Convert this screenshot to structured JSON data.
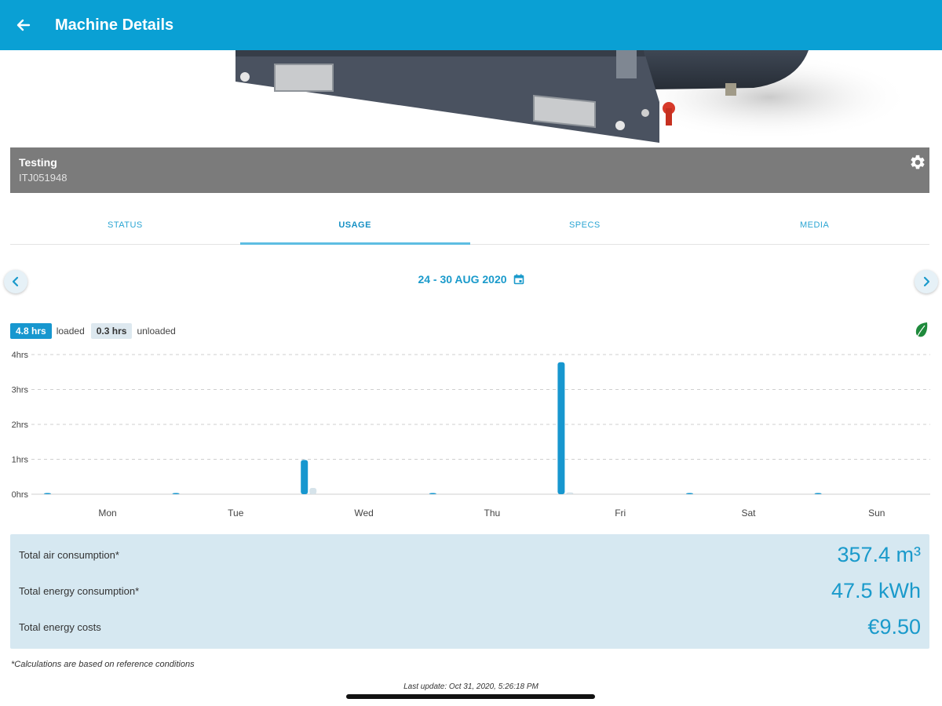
{
  "app": {
    "title": "Machine Details",
    "accent_color": "#0aa0d4"
  },
  "machine": {
    "name": "Testing",
    "id": "ITJ051948"
  },
  "tabs": [
    {
      "label": "STATUS",
      "active": false
    },
    {
      "label": "USAGE",
      "active": true
    },
    {
      "label": "SPECS",
      "active": false
    },
    {
      "label": "MEDIA",
      "active": false
    }
  ],
  "date_nav": {
    "range": "24 - 30 AUG 2020"
  },
  "usage_legend": {
    "loaded_value": "4.8 hrs",
    "loaded_label": "loaded",
    "unloaded_value": "0.3 hrs",
    "unloaded_label": "unloaded"
  },
  "chart_data": {
    "type": "bar",
    "categories": [
      "Mon",
      "Tue",
      "Wed",
      "Thu",
      "Fri",
      "Sat",
      "Sun"
    ],
    "y_ticks": [
      "0hrs",
      "1hrs",
      "2hrs",
      "3hrs",
      "4hrs"
    ],
    "ylim": [
      0,
      4
    ],
    "grid": true,
    "series": [
      {
        "name": "loaded",
        "color": "#1797cf",
        "values": [
          0.02,
          0.02,
          0.98,
          0.02,
          3.78,
          0.02,
          0.02
        ]
      },
      {
        "name": "unloaded",
        "color": "#d6e3ea",
        "values": [
          0,
          0,
          0.18,
          0,
          0.05,
          0,
          0
        ]
      }
    ]
  },
  "summary": {
    "rows": [
      {
        "label": "Total air consumption*",
        "value": "357.4 m³"
      },
      {
        "label": "Total energy consumption*",
        "value": "47.5 kWh"
      },
      {
        "label": "Total energy costs",
        "value": "€9.50"
      }
    ]
  },
  "footnote": "*Calculations are based on reference conditions",
  "last_update": "Last update: Oct 31, 2020, 5:26:18 PM",
  "icons": [
    "arrow-left-icon",
    "gear-icon",
    "chevron-left-icon",
    "chevron-right-icon",
    "calendar-icon",
    "leaf-icon"
  ]
}
